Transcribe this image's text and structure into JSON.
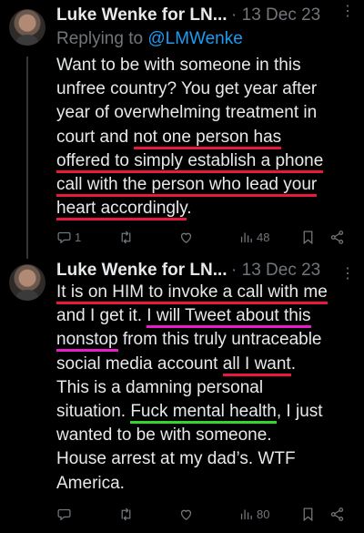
{
  "tweets": [
    {
      "author": "Luke Wenke for LN...",
      "date": "13 Dec 23",
      "separator": "·",
      "reply_prefix": "Replying to",
      "reply_handle": "@LMWenke",
      "lines": [
        {
          "parts": [
            {
              "t": "Want to be with someone in this"
            }
          ]
        },
        {
          "parts": [
            {
              "t": "unfree country?  You get year after"
            }
          ]
        },
        {
          "parts": [
            {
              "t": "year of overwhelming treatment in"
            }
          ]
        },
        {
          "parts": [
            {
              "t": "court and "
            },
            {
              "t": "not one person has",
              "u": "red"
            }
          ]
        },
        {
          "parts": [
            {
              "t": "offered to simply establish a phone",
              "u": "red"
            }
          ]
        },
        {
          "parts": [
            {
              "t": "call with the person who lead your",
              "u": "red"
            }
          ]
        },
        {
          "parts": [
            {
              "t": "heart accordingly",
              "u": "red"
            },
            {
              "t": "."
            }
          ]
        }
      ],
      "replies": "1",
      "views": "48"
    },
    {
      "author": "Luke Wenke for LN...",
      "date": "13 Dec 23",
      "separator": "·",
      "lines": [
        {
          "parts": [
            {
              "t": "It is on HIM to invoke a call with me",
              "u": "red"
            }
          ]
        },
        {
          "parts": [
            {
              "t": "and I get it.  "
            },
            {
              "t": "I will Tweet about this",
              "u": "pink"
            }
          ]
        },
        {
          "parts": [
            {
              "t": "nonstop",
              "u": "pink"
            },
            {
              "t": " from this truly untraceable"
            }
          ]
        },
        {
          "parts": [
            {
              "t": "social media account "
            },
            {
              "t": "all I want",
              "u": "red"
            },
            {
              "t": "."
            }
          ]
        },
        {
          "parts": [
            {
              "t": "This is a damning personal"
            }
          ]
        },
        {
          "parts": [
            {
              "t": "situation.  "
            },
            {
              "t": "Fuck mental health",
              "u": "green"
            },
            {
              "t": ", I just"
            }
          ]
        },
        {
          "parts": [
            {
              "t": "wanted to be with someone."
            }
          ]
        },
        {
          "parts": [
            {
              "t": "House arrest at my dad’s.  WTF"
            }
          ]
        },
        {
          "parts": [
            {
              "t": "America."
            }
          ]
        }
      ],
      "replies": "",
      "views": "80"
    }
  ],
  "icons": {
    "more": "more-icon",
    "reply": "reply-icon",
    "retweet": "retweet-icon",
    "like": "like-icon",
    "views": "views-icon",
    "bookmark": "bookmark-icon",
    "share": "share-icon"
  },
  "colors": {
    "background": "#000000",
    "text": "#e7e9ea",
    "muted": "#71767b",
    "link": "#1d9bf0",
    "underline_red": "#e8193c",
    "underline_pink": "#e81cc8",
    "underline_green": "#35d629"
  }
}
